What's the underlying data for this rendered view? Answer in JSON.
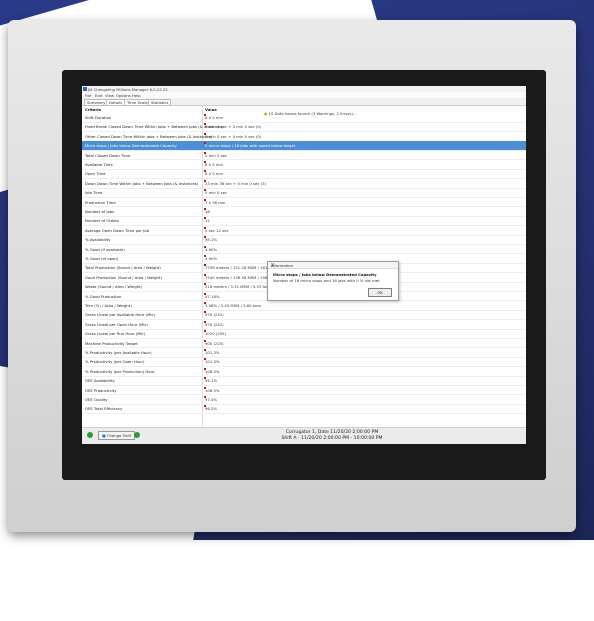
{
  "app": {
    "title": "JM Changeling Millions Manager 6.0.23.25",
    "menu": [
      "File",
      "Edit",
      "View",
      "Options",
      "Help"
    ],
    "tabs": [
      "Summary",
      "Details",
      "Time Scales",
      "Statistics"
    ],
    "active_tab": "Details",
    "warning": "10 Data issues found! (3 Warnings, 2 Errors)..."
  },
  "grid": {
    "col_criteria": "Criteria",
    "col_value": "Value",
    "rows": [
      {
        "criteria": "Shift Duration",
        "value": "8 h 0 min"
      },
      {
        "criteria": "Fixed Break Closed Down Time Within Jobs + Between Jobs (& Instances)",
        "value": "0 min 0 sec + 0 min 0 sec (0)"
      },
      {
        "criteria": "Other Closed Down Time Within Jobs + Between Jobs (& Instances)",
        "value": "0 min 0 sec + 0 min 0 sec (0)"
      },
      {
        "criteria": "Micro stops / Jobs below Demonstrated Capacity",
        "value": "0 micro stops / 16 jobs with speed below target",
        "selected": true
      },
      {
        "criteria": "Total Closed Down Time",
        "value": "0 min 0 sec"
      },
      {
        "criteria": "Available Time",
        "value": "8 h 0 min"
      },
      {
        "criteria": "Open Time",
        "value": "8 h 0 min"
      },
      {
        "criteria": "Down Down Time Within Jobs + Between Jobs (& Instances)",
        "value": "23 min 36 sec + 0 min 0 sec (3)"
      },
      {
        "criteria": "Idle Time",
        "value": "0 min 0 sec"
      },
      {
        "criteria": "Production Time",
        "value": "7 h 36 min"
      },
      {
        "criteria": "Number of Jobs",
        "value": "16"
      },
      {
        "criteria": "Number of Orders",
        "value": "12"
      },
      {
        "criteria": "Average Open Down Time per Job",
        "value": "0 sec 12 sec"
      },
      {
        "criteria": "% Availability",
        "value": "95.1%"
      },
      {
        "criteria": "% Good (if available)",
        "value": "4.90%"
      },
      {
        "criteria": "% Good (of open)",
        "value": "4.90%"
      },
      {
        "criteria": "Total Production (Sound / Area / Weight)",
        "value": "7756 meters / 151.26 MSM / 161.79 tons"
      },
      {
        "criteria": "Good Production (Sound / Area / Weight)",
        "value": "7540 meters / 136.38 MSM / 156.26 tons"
      },
      {
        "criteria": "Waste (Sound / Area / Weight)",
        "value": "216 meters / 5.31 MSM / 5.53 tons"
      },
      {
        "criteria": "% Good Production",
        "value": "97.18%"
      },
      {
        "criteria": "Trim (%) / Area / Weight)",
        "value": "3.56% / 5.43 MSM / 5.60 tons"
      },
      {
        "criteria": "Gross Lineal per Available Hour (Mtr)",
        "value": "970 (242)"
      },
      {
        "criteria": "Gross Lineal per Open Hour (Mtr)",
        "value": "970 (242)"
      },
      {
        "criteria": "Gross Lineal per Run Hour (Mtr)",
        "value": "1020 (255)"
      },
      {
        "criteria": "Machine Productivity Target",
        "value": "900 (225)"
      },
      {
        "criteria": "% Productivity (per Available Hour)",
        "value": "101.3%"
      },
      {
        "criteria": "% Productivity (per Open Hour)",
        "value": "101.3%"
      },
      {
        "criteria": "% Productivity (per Production) Hour",
        "value": "106.5%"
      },
      {
        "criteria": "OEE Availability",
        "value": "95.1%"
      },
      {
        "criteria": "OEE Productivity",
        "value": "106.5%"
      },
      {
        "criteria": "OEE Quality",
        "value": "97.4%"
      },
      {
        "criteria": "OEE Total Efficiency",
        "value": "96.2%"
      }
    ]
  },
  "dialog": {
    "title": "Information",
    "close": "X",
    "heading": "Micro stops / Jobs below Demonstrated Capacity",
    "body": "Number of 16 micro stops and 16 jobs with 0 % not met",
    "ok": "OK"
  },
  "footer": {
    "change_shift": "Change Shift",
    "line1": "Corrugator 1, Date 11/20/20 2:00:00 PM",
    "line2": "Shift A - 11/20/20 2:00:00 PM - 10:00:00 PM"
  },
  "colors": {
    "selection": "#4a8fd8",
    "marker": "#c0181c",
    "ok_green": "#2e9a3a",
    "background_blue": "#24306e"
  }
}
